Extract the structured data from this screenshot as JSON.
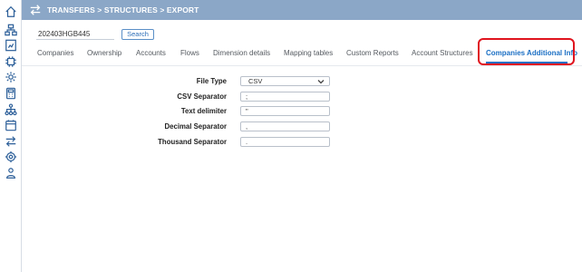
{
  "header": {
    "breadcrumb": "TRANSFERS > STRUCTURES > EXPORT"
  },
  "toolbar": {
    "code_value": "202403HGB445",
    "search_label": "Search"
  },
  "tabs": [
    {
      "label": "Companies"
    },
    {
      "label": "Ownership"
    },
    {
      "label": "Accounts"
    },
    {
      "label": "Flows"
    },
    {
      "label": "Dimension details"
    },
    {
      "label": "Mapping tables"
    },
    {
      "label": "Custom Reports"
    },
    {
      "label": "Account Structures"
    },
    {
      "label": "Companies Additional Info"
    }
  ],
  "form": {
    "file_type": {
      "label": "File Type",
      "value": "CSV"
    },
    "csv_separator": {
      "label": "CSV Separator",
      "value": ";"
    },
    "text_delimiter": {
      "label": "Text delimiter",
      "value": "\""
    },
    "decimal_separator": {
      "label": "Decimal Separator",
      "value": ","
    },
    "thousand_separator": {
      "label": "Thousand Separator",
      "value": "."
    }
  },
  "colors": {
    "header_bg": "#8ba7c7",
    "accent": "#1b6fc4",
    "highlight": "#e0141e"
  },
  "rail_icons": [
    "home-icon",
    "hierarchy-icon",
    "report-icon",
    "chip-icon",
    "settings-gear-icon",
    "calculator-icon",
    "org-chart-icon",
    "calendar-icon",
    "transfer-arrows-icon",
    "gear-cog-icon",
    "users-icon"
  ]
}
